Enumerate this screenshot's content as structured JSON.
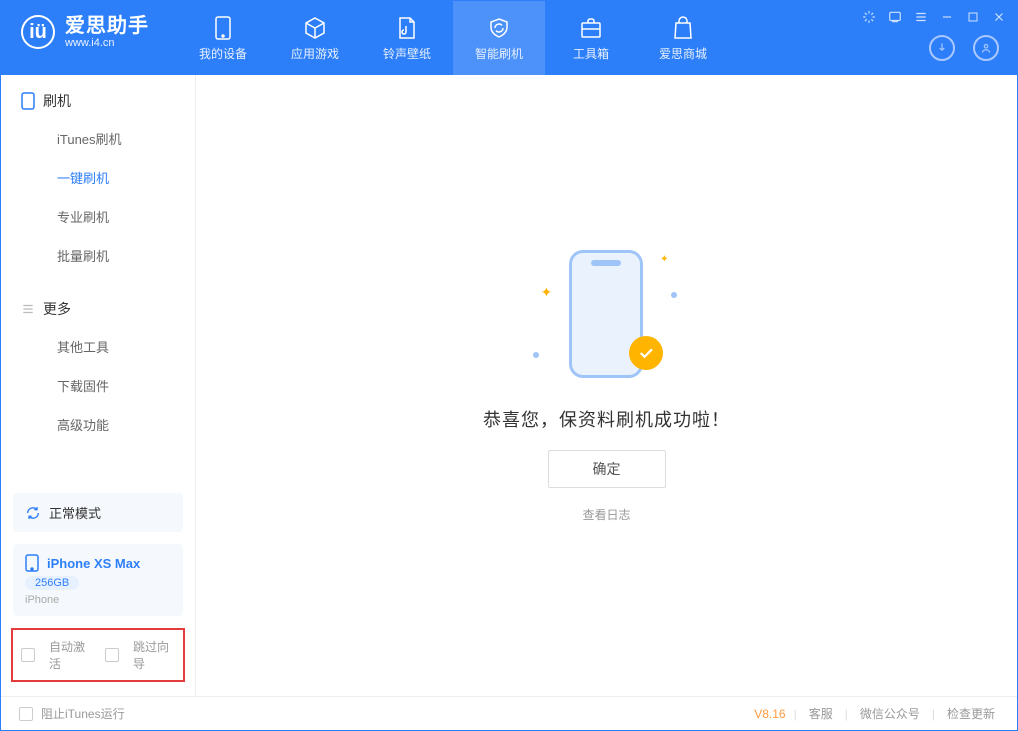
{
  "app": {
    "name_cn": "爱思助手",
    "url": "www.i4.cn"
  },
  "nav": {
    "items": [
      {
        "label": "我的设备"
      },
      {
        "label": "应用游戏"
      },
      {
        "label": "铃声壁纸"
      },
      {
        "label": "智能刷机"
      },
      {
        "label": "工具箱"
      },
      {
        "label": "爱思商城"
      }
    ]
  },
  "sidebar": {
    "section_flash": {
      "title": "刷机",
      "items": [
        "iTunes刷机",
        "一键刷机",
        "专业刷机",
        "批量刷机"
      ]
    },
    "section_more": {
      "title": "更多",
      "items": [
        "其他工具",
        "下载固件",
        "高级功能"
      ]
    },
    "mode_card": {
      "label": "正常模式"
    },
    "device_card": {
      "name": "iPhone XS Max",
      "storage": "256GB",
      "type": "iPhone"
    },
    "checks": {
      "auto_activate": "自动激活",
      "skip_guide": "跳过向导"
    }
  },
  "main": {
    "success_text": "恭喜您，保资料刷机成功啦！",
    "ok_button": "确定",
    "view_log": "查看日志"
  },
  "footer": {
    "block_itunes": "阻止iTunes运行",
    "version": "V8.16",
    "links": {
      "service": "客服",
      "wechat": "微信公众号",
      "update": "检查更新"
    }
  }
}
